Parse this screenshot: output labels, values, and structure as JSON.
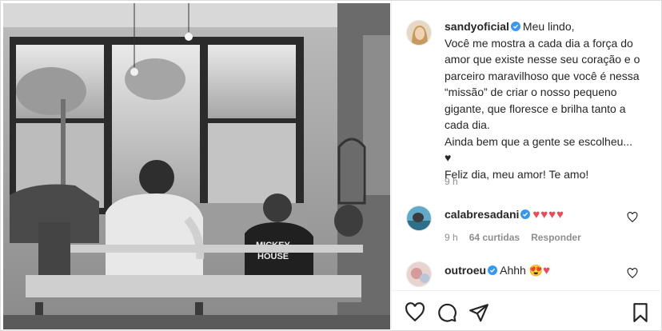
{
  "post": {
    "username": "sandyoficial",
    "caption_first": "Meu lindo,",
    "caption_body": "Você me mostra a cada dia a força do amor que existe nesse seu coração e o parceiro maravilhoso que você é nessa “missão” de criar o nosso pequeno gigante, que floresce e brilha tanto a cada dia.\nAinda bem que a gente se escolheu... \n♥\nFeliz dia, meu amor! Te amo!",
    "time": "9 h"
  },
  "comments": [
    {
      "username": "calabresadani",
      "text": "♥♥♥♥",
      "time": "9 h",
      "likes": "64 curtidas",
      "reply": "Responder"
    },
    {
      "username": "outroeu",
      "text": "Ahhh",
      "emoji": "😍",
      "hearts": "♥"
    }
  ],
  "icons": {
    "verified": "verified-badge-icon",
    "like": "heart-outline-icon",
    "comment": "comment-bubble-icon",
    "share": "paper-plane-icon",
    "save": "bookmark-icon"
  },
  "colors": {
    "verified": "#3897f0",
    "heart": "#ed4956",
    "muted": "#8e8e8e"
  }
}
